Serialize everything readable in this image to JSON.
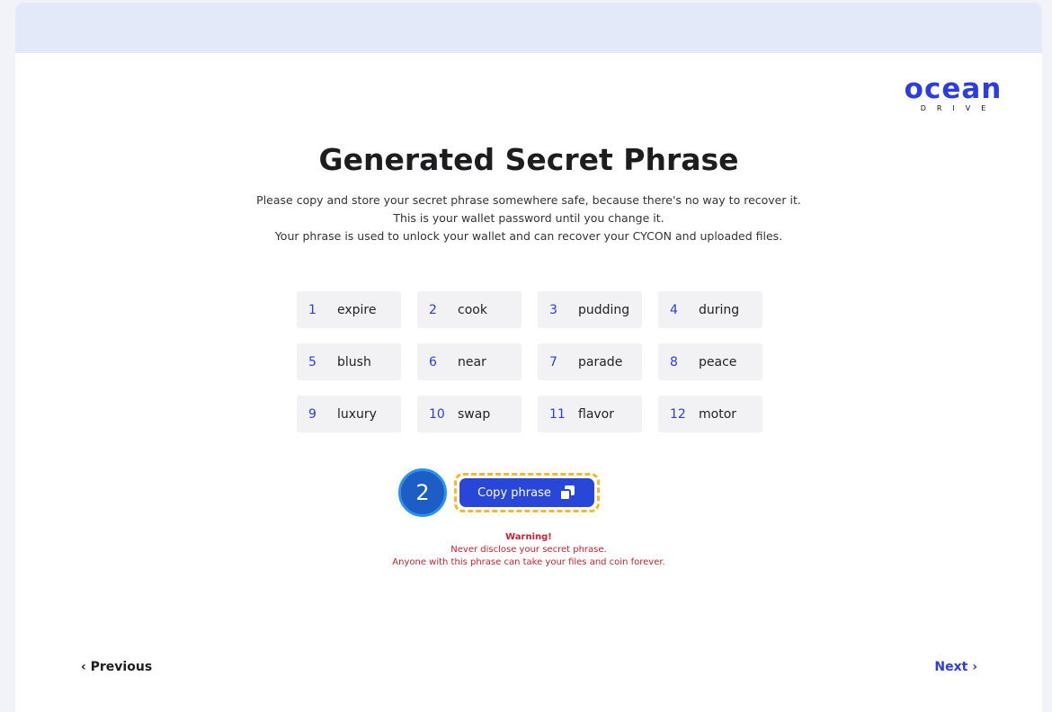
{
  "brand": {
    "logo_text": "ocean",
    "logo_sub": "DRIVE",
    "accent": "#2b3de0"
  },
  "title": "Generated Secret Phrase",
  "description": [
    "Please copy and store your secret phrase somewhere safe, because there's no way to recover it.",
    "This is your wallet password until you change it.",
    "Your phrase is used to unlock your wallet and can recover your CYCON and uploaded files."
  ],
  "words": [
    {
      "num": "1",
      "word": "expire"
    },
    {
      "num": "2",
      "word": "cook"
    },
    {
      "num": "3",
      "word": "pudding"
    },
    {
      "num": "4",
      "word": "during"
    },
    {
      "num": "5",
      "word": "blush"
    },
    {
      "num": "6",
      "word": "near"
    },
    {
      "num": "7",
      "word": "parade"
    },
    {
      "num": "8",
      "word": "peace"
    },
    {
      "num": "9",
      "word": "luxury"
    },
    {
      "num": "10",
      "word": "swap"
    },
    {
      "num": "11",
      "word": "flavor"
    },
    {
      "num": "12",
      "word": "motor"
    }
  ],
  "copy_button": {
    "label": "Copy phrase",
    "icon": "copy-icon"
  },
  "step_badge": "2",
  "warning": {
    "title": "Warning!",
    "lines": [
      "Never disclose your secret phrase.",
      "Anyone with this phrase can take your files and coin forever."
    ]
  },
  "nav": {
    "prev": "‹ Previous",
    "next": "Next ›"
  }
}
